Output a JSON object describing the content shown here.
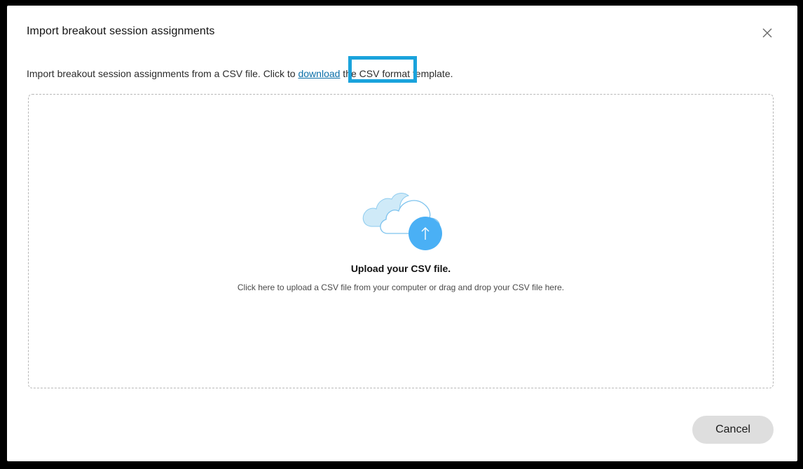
{
  "dialog": {
    "title": "Import breakout session assignments",
    "close_icon": "close-icon",
    "description": {
      "before": "Import breakout session assignments from a CSV file. Click to ",
      "link": "download",
      "after": " the CSV format template."
    },
    "dropzone": {
      "icon": "cloud-upload-icon",
      "title": "Upload your CSV file.",
      "subtitle": "Click here to upload a CSV file from your computer or drag and drop your CSV file here."
    },
    "cancel_label": "Cancel"
  },
  "colors": {
    "link": "#0a6ea8",
    "highlight": "#1aa3dc",
    "upload_accent": "#4ab0f5",
    "cloud_fill": "#cfeaf8"
  }
}
